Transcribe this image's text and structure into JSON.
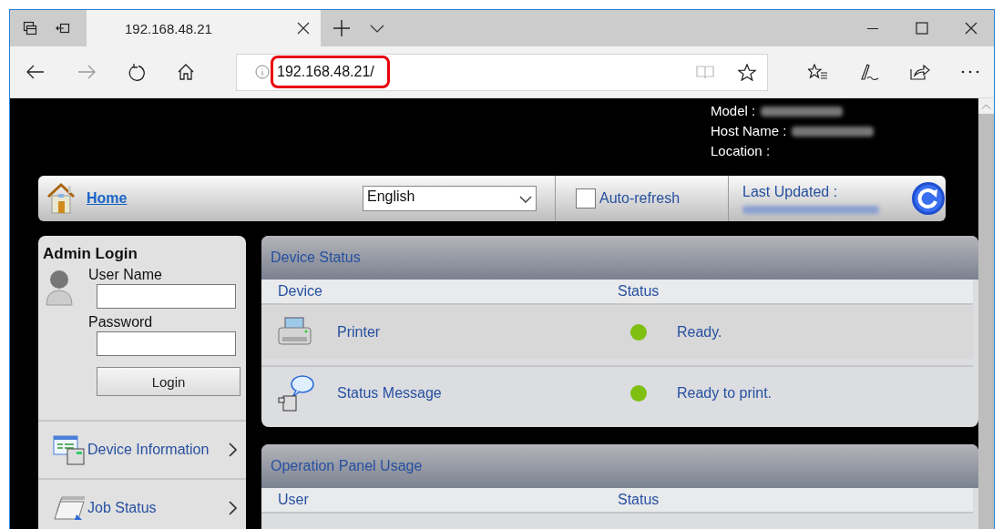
{
  "browser": {
    "tabs": [
      {
        "title": "192.168.48.21",
        "selected": true
      }
    ],
    "address": "192.168.48.21/"
  },
  "header": {
    "fields": [
      {
        "label": "Model :",
        "redacted": true
      },
      {
        "label": "Host Name :",
        "redacted": true
      },
      {
        "label": "Location :",
        "redacted": false
      }
    ]
  },
  "navbar": {
    "home": "Home",
    "language": "English",
    "auto_refresh": {
      "label": "Auto-refresh",
      "checked": false
    },
    "last_updated": "Last Updated :"
  },
  "login": {
    "title": "Admin Login",
    "user_label": "User Name",
    "password_label": "Password",
    "button": "Login"
  },
  "menu": [
    {
      "label": "Device Information",
      "kind": "info"
    },
    {
      "label": "Job Status",
      "kind": "jobs"
    }
  ],
  "device_status": {
    "title": "Device Status",
    "columns": [
      "Device",
      "Status"
    ],
    "rows": [
      {
        "kind": "printer",
        "device": "Printer",
        "status": "Ready.",
        "color": "#7fbf12"
      },
      {
        "kind": "message",
        "device": "Status Message",
        "status": "Ready to print.",
        "color": "#7fbf12"
      }
    ]
  },
  "operation_panel": {
    "title": "Operation Panel Usage",
    "columns": [
      "User",
      "Status"
    ]
  }
}
